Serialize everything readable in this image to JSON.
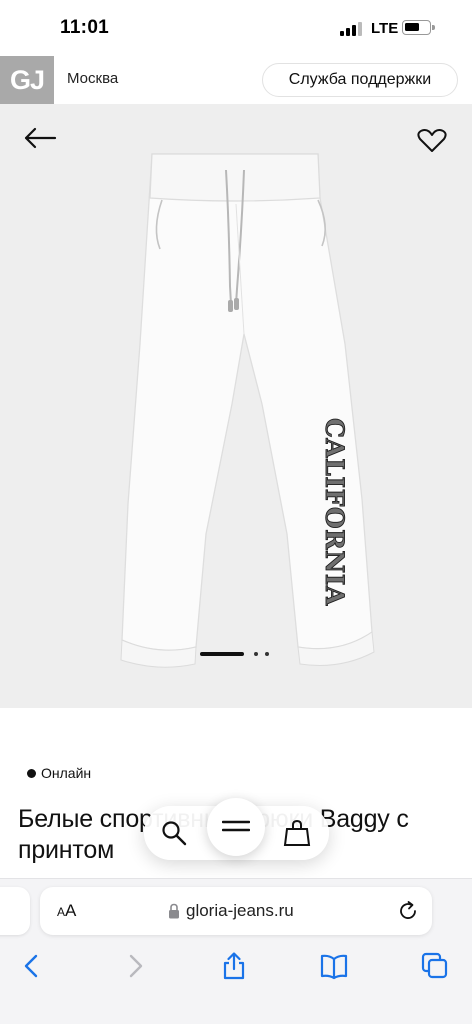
{
  "status_bar": {
    "time": "11:01",
    "network": "LTE"
  },
  "header": {
    "logo": "GJ",
    "city": "Москва",
    "support_label": "Служба поддержки"
  },
  "product": {
    "print_text": "CALIFORNIA",
    "availability": "Онлайн",
    "title": "Белые спортивные брюки Baggy с принтом"
  },
  "browser": {
    "text_size_label_small": "A",
    "text_size_label_large": "A",
    "url": "gloria-jeans.ru"
  },
  "colors": {
    "logo_bg": "#a9a9a9",
    "image_bg": "#eeeeee",
    "safari_blue": "#1a73e8"
  }
}
